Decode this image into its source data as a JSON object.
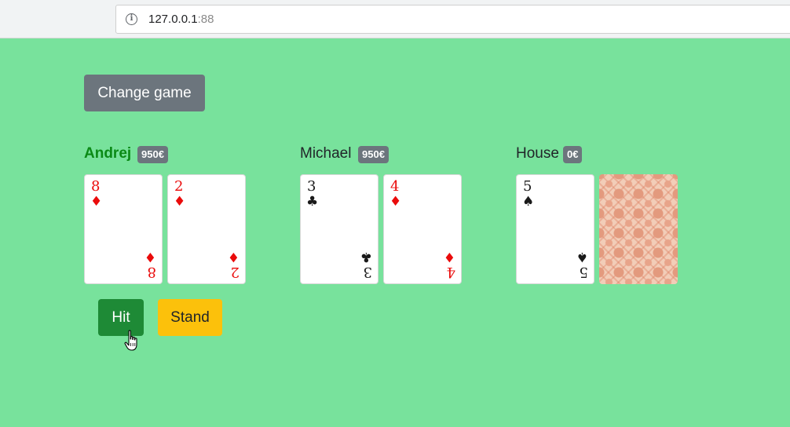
{
  "browser": {
    "url_host": "127.0.0.1",
    "url_port": ":88"
  },
  "toolbar": {
    "change_game_label": "Change game"
  },
  "players": [
    {
      "name": "Andrej",
      "balance": "950€",
      "active": true,
      "cards": [
        {
          "rank": "8",
          "suit": "♦",
          "color": "red"
        },
        {
          "rank": "2",
          "suit": "♦",
          "color": "red"
        }
      ]
    },
    {
      "name": "Michael",
      "balance": "950€",
      "active": false,
      "cards": [
        {
          "rank": "3",
          "suit": "♣",
          "color": "black"
        },
        {
          "rank": "4",
          "suit": "♦",
          "color": "red"
        }
      ]
    },
    {
      "name": "House",
      "balance": "0€",
      "active": false,
      "cards": [
        {
          "rank": "5",
          "suit": "♠",
          "color": "black"
        },
        {
          "face_down": true
        }
      ]
    }
  ],
  "actions": {
    "hit_label": "Hit",
    "stand_label": "Stand"
  },
  "colors": {
    "table_green": "#78e29c",
    "active_player": "#0b8a16",
    "hit_button": "#1e8a36",
    "stand_button": "#fcc10b",
    "secondary_button": "#6c757d",
    "red_suit": "#ea0b0b"
  }
}
